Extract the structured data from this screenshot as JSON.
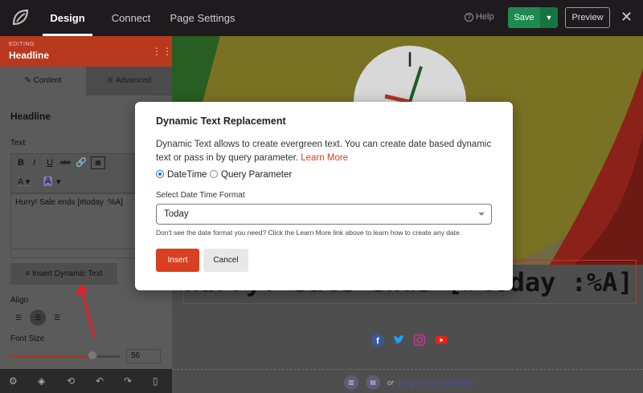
{
  "topbar": {
    "tabs": [
      {
        "label": "Design",
        "active": true
      },
      {
        "label": "Connect",
        "active": false
      },
      {
        "label": "Page Settings",
        "active": false
      }
    ],
    "help_label": "Help",
    "save_label": "Save",
    "preview_label": "Preview",
    "close_icon": "close-icon"
  },
  "sidebar": {
    "editing_small": "EDITING",
    "editing_title": "Headline",
    "tabs": [
      {
        "label": "Content",
        "icon": "pencil-icon",
        "active": true
      },
      {
        "label": "Advanced",
        "icon": "sliders-icon",
        "active": false
      }
    ],
    "section_title": "Headline",
    "text_label": "Text",
    "editor_text": "Hurry! Sale ends [#today :%A]",
    "insert_dynamic_label": "Insert Dynamic Text",
    "align_label": "Align",
    "font_size_label": "Font Size",
    "font_size_value": "56",
    "font_size_fraction": 0.75
  },
  "canvas": {
    "headline": "Hurry! Sale ends [#today :%A]",
    "dropzone_or": "or",
    "dropzone_link": "Drag a new block here"
  },
  "modal": {
    "title": "Dynamic Text Replacement",
    "description": "Dynamic Text allows to create evergreen text. You can create date based dynamic text or pass in by query parameter.",
    "learn_more": "Learn More",
    "radio_datetime": "DateTime",
    "radio_query": "Query Parameter",
    "select_label": "Select Date Time Format",
    "select_value": "Today",
    "hint": "Don't see the date format you need? Click the Learn More link above to learn how to create any date.",
    "insert_label": "Insert",
    "cancel_label": "Cancel"
  },
  "colors": {
    "accent": "#d94020",
    "save_green": "#1e8a4e",
    "editing_bar": "#b9391f"
  }
}
